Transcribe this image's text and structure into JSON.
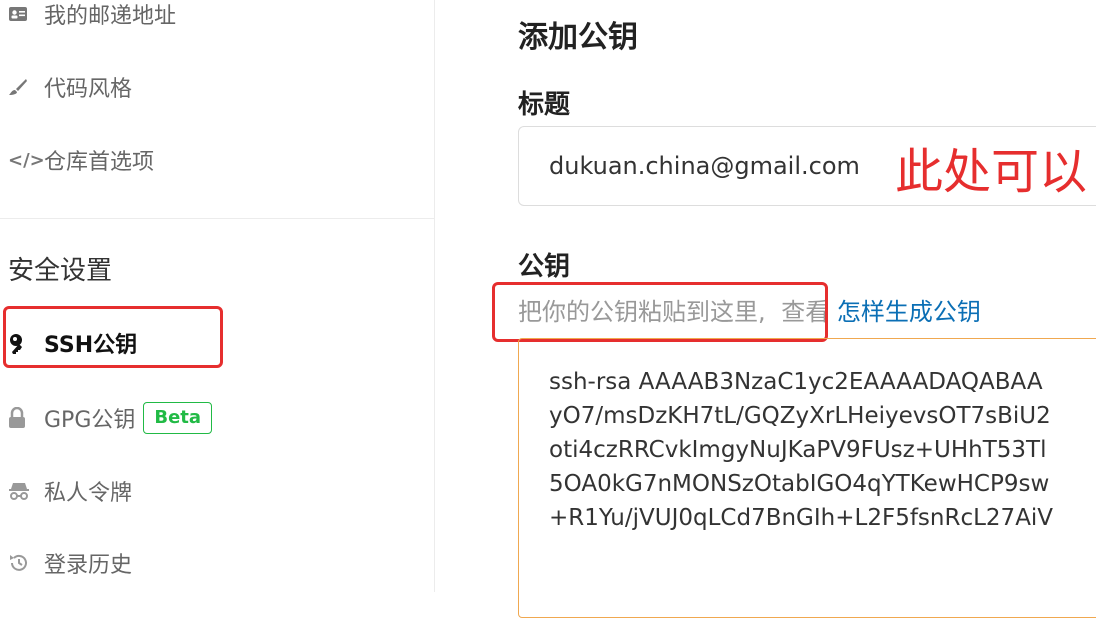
{
  "sidebar": {
    "items_top": [
      {
        "label": "我的邮递地址",
        "icon": "address-card-icon"
      },
      {
        "label": "代码风格",
        "icon": "brush-icon"
      },
      {
        "label": "仓库首选项",
        "icon": "code-icon"
      }
    ],
    "security_section": {
      "title": "安全设置",
      "items": [
        {
          "label": "SSH公钥",
          "icon": "key-icon",
          "active": true
        },
        {
          "label": "GPG公钥",
          "icon": "lock-icon",
          "badge": "Beta"
        },
        {
          "label": "私人令牌",
          "icon": "incognito-icon"
        },
        {
          "label": "登录历史",
          "icon": "history-icon"
        }
      ]
    }
  },
  "main": {
    "title": "添加公钥",
    "title_field_label": "标题",
    "title_field_value": "dukuan.china@gmail.com",
    "annotation": "此处可以",
    "key_field_label": "公钥",
    "key_hint": "把你的公钥粘贴到这里,",
    "key_hint_view": "查看",
    "key_hint_link": "怎样生成公钥",
    "key_value": "ssh-rsa AAAAB3NzaC1yc2EAAAADAQABAA\nyO7/msDzKH7tL/GQZyXrLHeiyevsOT7sBiU2\noti4czRRCvkImgyNuJKaPV9FUsz+UHhT53Tl\n5OA0kG7nMONSzOtabIGO4qYTKewHCP9sw\n+R1Yu/jVUJ0qLCd7BnGIh+L2F5fsnRcL27AiV"
  },
  "colors": {
    "highlight": "#e62e2e",
    "badge": "#21ba45",
    "link": "#0b6fb5",
    "textarea_border": "#f0a850"
  }
}
